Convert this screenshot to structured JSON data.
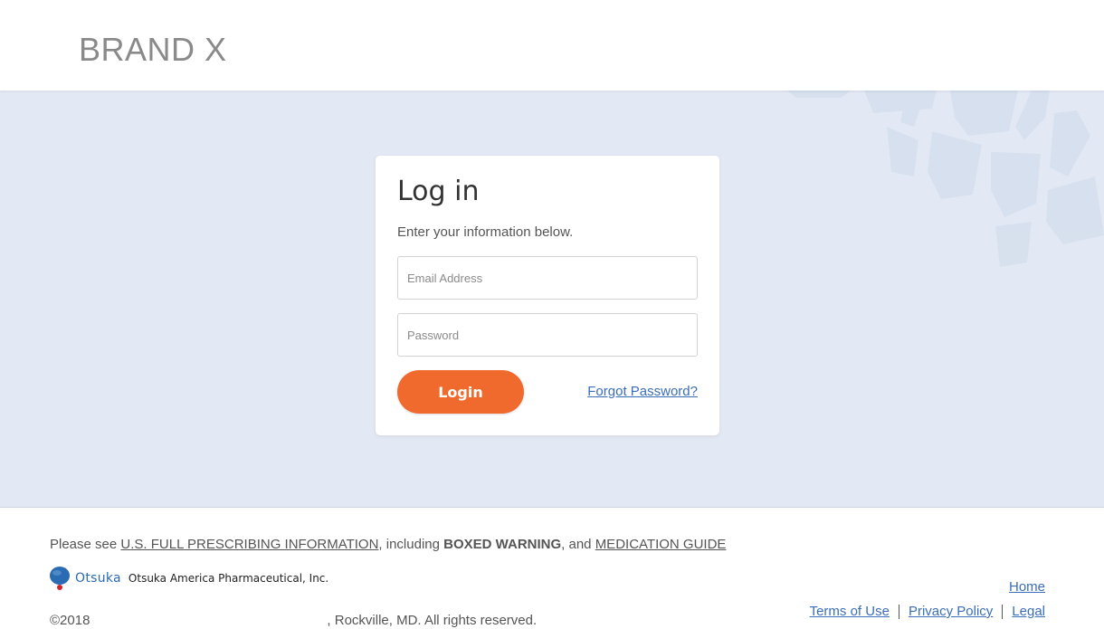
{
  "header": {
    "brand": "BRAND X"
  },
  "login": {
    "title": "Log in",
    "subtitle": "Enter your information below.",
    "email_placeholder": "Email Address",
    "password_placeholder": "Password",
    "login_label": "Login",
    "forgot_label": "Forgot Password?",
    "button_color": "#f06a2e"
  },
  "footer": {
    "pi_prefix": "Please see ",
    "pi_link": "U.S. FULL PRESCRIBING INFORMATION",
    "pi_mid": ", including ",
    "boxed_warning": "BOXED WARNING",
    "pi_and": ", and ",
    "med_guide": "MEDICATION GUIDE",
    "otsuka_word": "Otsuka",
    "otsuka_full": "Otsuka America Pharmaceutical, Inc.",
    "copyright_year": "©2018",
    "copyright_rest": ", Rockville, MD. All rights reserved.",
    "home": "Home",
    "terms": "Terms of Use",
    "privacy": "Privacy Policy",
    "legal": "Legal"
  },
  "colors": {
    "link": "#3b6eb8",
    "hero_bg": "#e3e9f4",
    "otsuka_blue": "#2a6bb3"
  },
  "icons": {
    "otsuka_logo": "otsuka-logo-icon"
  }
}
